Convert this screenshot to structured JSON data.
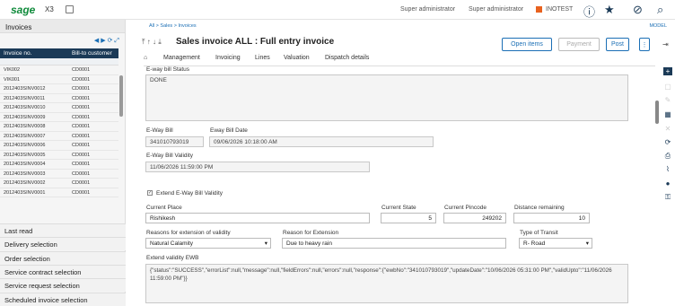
{
  "header": {
    "logo": "sage",
    "product": "X3",
    "user1": "Super administrator",
    "user2": "Super administrator",
    "folder": "INOTEST",
    "folder_color": "#e8621f"
  },
  "sidebar": {
    "title": "Invoices",
    "col1": "Invoice no.",
    "col2": "Bill-to customer",
    "rows": [
      [
        "VIK002",
        "CD0001"
      ],
      [
        "VIK001",
        "CD0001"
      ],
      [
        "2012403SINV0012",
        "CD0001"
      ],
      [
        "2012403SINV0011",
        "CD0001"
      ],
      [
        "2012403SINV0010",
        "CD0001"
      ],
      [
        "2012403SINV0009",
        "CD0001"
      ],
      [
        "2012403SINV0008",
        "CD0001"
      ],
      [
        "2012403SINV0007",
        "CD0001"
      ],
      [
        "2012403SINV0006",
        "CD0001"
      ],
      [
        "2012403SINV0005",
        "CD0001"
      ],
      [
        "2012403SINV0004",
        "CD0001"
      ],
      [
        "2012403SINV0003",
        "CD0001"
      ],
      [
        "2012403SINV0002",
        "CD0001"
      ],
      [
        "2012403SINV0001",
        "CD0001"
      ]
    ],
    "nav": [
      "Last read",
      "Delivery selection",
      "Order selection",
      "Service contract selection",
      "Service request selection",
      "Scheduled invoice selection"
    ]
  },
  "main": {
    "breadcrumb": [
      "All",
      "Sales",
      "Invoices"
    ],
    "model": "MODEL",
    "title": "Sales invoice ALL : Full entry invoice",
    "buttons": {
      "open_items": "Open items",
      "payment": "Payment",
      "post": "Post"
    },
    "tabs": [
      "Management",
      "Invoicing",
      "Lines",
      "Valuation",
      "Dispatch details"
    ],
    "ewb_status_label": "E-way bill Status",
    "ewb_status": "DONE",
    "eway_bill_label": "E-Way Bill",
    "eway_bill": "341010793019",
    "eway_date_label": "Eway Bill Date",
    "eway_date": "09/06/2026 10:18:00 AM",
    "validity_label": "E-Way Bill Validity",
    "validity": "11/06/2026 11:59:00 PM",
    "extend_label": "Extend E-Way Bill Validity",
    "current_place_label": "Current Place",
    "current_place": "Rishikesh",
    "current_state_label": "Current State",
    "current_state": "5",
    "current_pincode_label": "Current Pincode",
    "current_pincode": "249202",
    "distance_label": "Distance remaining",
    "distance": "10",
    "reason_ext_label": "Reasons for extension of validity",
    "reason_ext": "Natural Calamity",
    "reason_label": "Reason for Extension",
    "reason": "Due to heavy rain",
    "transit_label": "Type of Transit",
    "transit": "R- Road",
    "ext_validity_label": "Extend validity EWB",
    "ext_validity": "{\"status\":\"SUCCESS\",\"errorList\":null,\"message\":null,\"fieldErrors\":null,\"errors\":null,\"response\":{\"ewbNo\":\"341010793019\",\"updateDate\":\"10/06/2026 05:31:00 PM\",\"validUpto\":\"11/06/2026 11:59:00 PM\"}}"
  }
}
